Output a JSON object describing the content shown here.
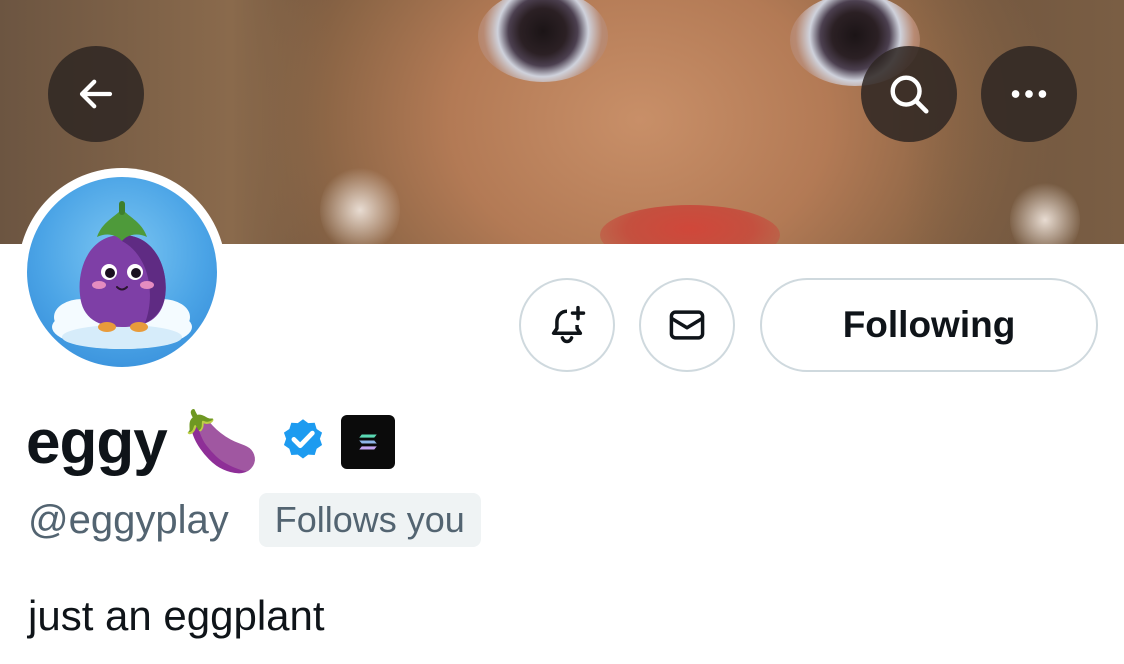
{
  "header": {
    "back_icon": "arrow-left-icon",
    "search_icon": "search-icon",
    "more_icon": "more-horizontal-icon"
  },
  "profile": {
    "display_name": "eggy",
    "name_emoji": "🍆",
    "verified_icon": "verified-badge-icon",
    "affiliation_icon": "solana-logo-icon",
    "handle": "@eggyplay",
    "follows_you": "Follows you",
    "bio": "just an eggplant",
    "avatar_icon": "eggplant-avatar"
  },
  "actions": {
    "notify_icon": "bell-plus-icon",
    "message_icon": "mail-icon",
    "follow_label": "Following"
  },
  "colors": {
    "verified_blue": "#1d9bf0",
    "text_primary": "#0f1419",
    "text_secondary": "#536471",
    "border": "#cfd9de"
  }
}
